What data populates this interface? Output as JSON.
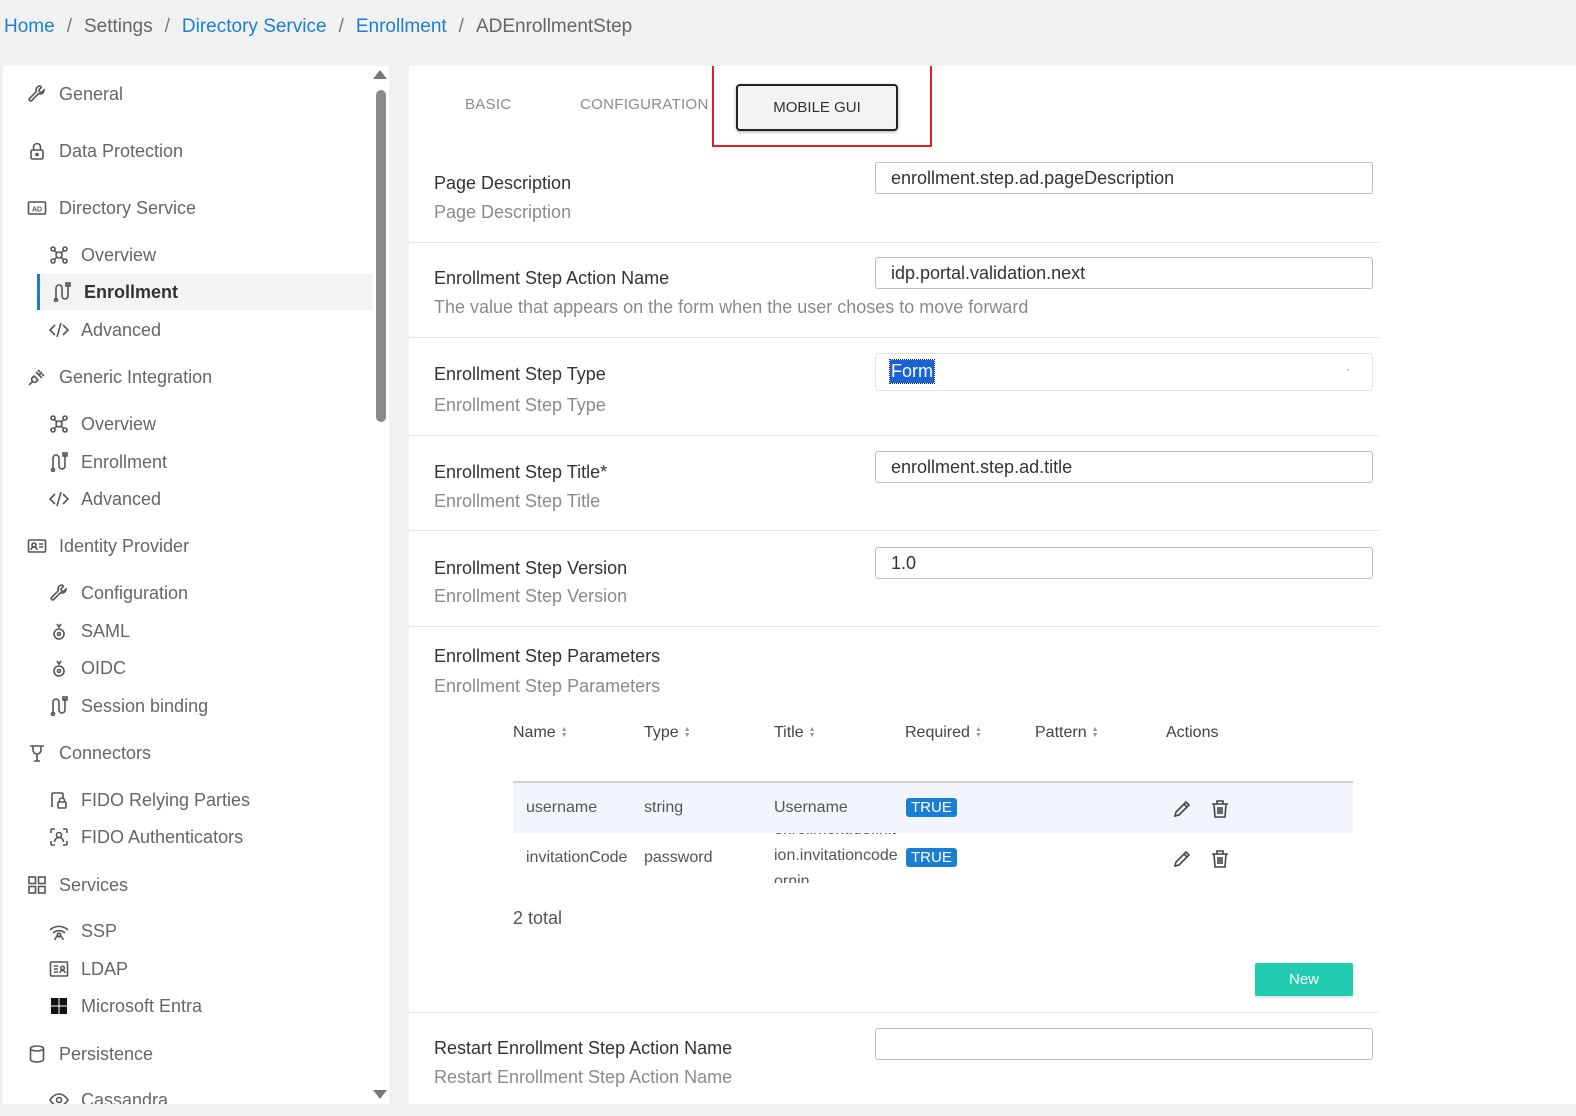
{
  "breadcrumb": {
    "home": "Home",
    "settings": "Settings",
    "directory_service": "Directory Service",
    "enrollment": "Enrollment",
    "current": "ADEnrollmentStep",
    "separator": "/"
  },
  "sidebar": {
    "general": "General",
    "data_protection": "Data Protection",
    "directory_service": "Directory Service",
    "ds_overview": "Overview",
    "ds_enrollment": "Enrollment",
    "ds_advanced": "Advanced",
    "generic_integration": "Generic Integration",
    "gi_overview": "Overview",
    "gi_enrollment": "Enrollment",
    "gi_advanced": "Advanced",
    "identity_provider": "Identity Provider",
    "idp_configuration": "Configuration",
    "idp_saml": "SAML",
    "idp_oidc": "OIDC",
    "idp_session_binding": "Session binding",
    "connectors": "Connectors",
    "fido_relying_parties": "FIDO Relying Parties",
    "fido_authenticators": "FIDO Authenticators",
    "services": "Services",
    "ssp": "SSP",
    "ldap": "LDAP",
    "microsoft_entra": "Microsoft Entra",
    "persistence": "Persistence",
    "cassandra": "Cassandra"
  },
  "tabs": {
    "basic": "BASIC",
    "configuration": "CONFIGURATION",
    "mobile_gui": "MOBILE GUI"
  },
  "fields": {
    "page_description": {
      "title": "Page Description",
      "desc": "Page Description",
      "value": "enrollment.step.ad.pageDescription"
    },
    "action_name": {
      "title": "Enrollment Step Action Name",
      "desc": "The value that appears on the form when the user choses to move forward",
      "value": "idp.portal.validation.next"
    },
    "step_type": {
      "title": "Enrollment Step Type",
      "desc": "Enrollment Step Type",
      "value": "Form"
    },
    "step_title": {
      "title": "Enrollment Step Title*",
      "desc": "Enrollment Step Title",
      "value": "enrollment.step.ad.title"
    },
    "step_version": {
      "title": "Enrollment Step Version",
      "desc": "Enrollment Step Version",
      "value": "1.0"
    },
    "step_parameters": {
      "title": "Enrollment Step Parameters",
      "desc": "Enrollment Step Parameters"
    },
    "restart_action": {
      "title": "Restart Enrollment Step Action Name",
      "desc": "Restart Enrollment Step Action Name",
      "value": ""
    }
  },
  "table": {
    "headers": {
      "name": "Name",
      "type": "Type",
      "title": "Title",
      "required": "Required",
      "pattern": "Pattern",
      "actions": "Actions"
    },
    "rows": [
      {
        "name": "username",
        "type": "string",
        "title_line1": "Username",
        "required": "TRUE"
      },
      {
        "name": "invitationCode",
        "type": "password",
        "title_line1": "enrollment.definit",
        "title_line2": "ion.invitationcode",
        "title_line3": "ornin",
        "required": "TRUE"
      }
    ],
    "total": "2 total",
    "new_label": "New"
  },
  "colors": {
    "link": "#1a7fd4",
    "badge": "#1a7fd4",
    "new_button": "#22ccb1",
    "highlight": "#e02020"
  }
}
